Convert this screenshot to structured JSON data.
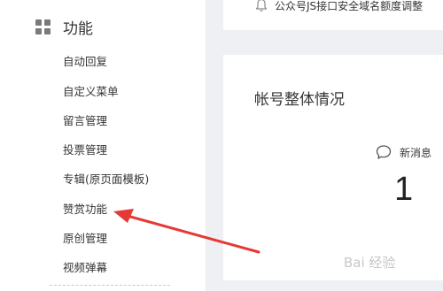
{
  "sidebar": {
    "section_title": "功能",
    "section_icon": "grid-icon",
    "items": [
      {
        "label": "自动回复"
      },
      {
        "label": "自定义菜单"
      },
      {
        "label": "留言管理"
      },
      {
        "label": "投票管理"
      },
      {
        "label": "专辑(原页面模板)"
      },
      {
        "label": "赞赏功能"
      },
      {
        "label": "原创管理"
      },
      {
        "label": "视频弹幕"
      }
    ]
  },
  "notice": {
    "icon": "bell-icon",
    "text": "公众号JS接口安全域名额度调整"
  },
  "account_card": {
    "title": "帐号整体情况",
    "stat": {
      "icon": "chat-bubble-icon",
      "label": "新消息",
      "value": "1"
    }
  },
  "annotation": {
    "arrow_color": "#e53935",
    "points_to": "赞赏功能"
  },
  "watermark": {
    "text": "Bai 经验"
  }
}
